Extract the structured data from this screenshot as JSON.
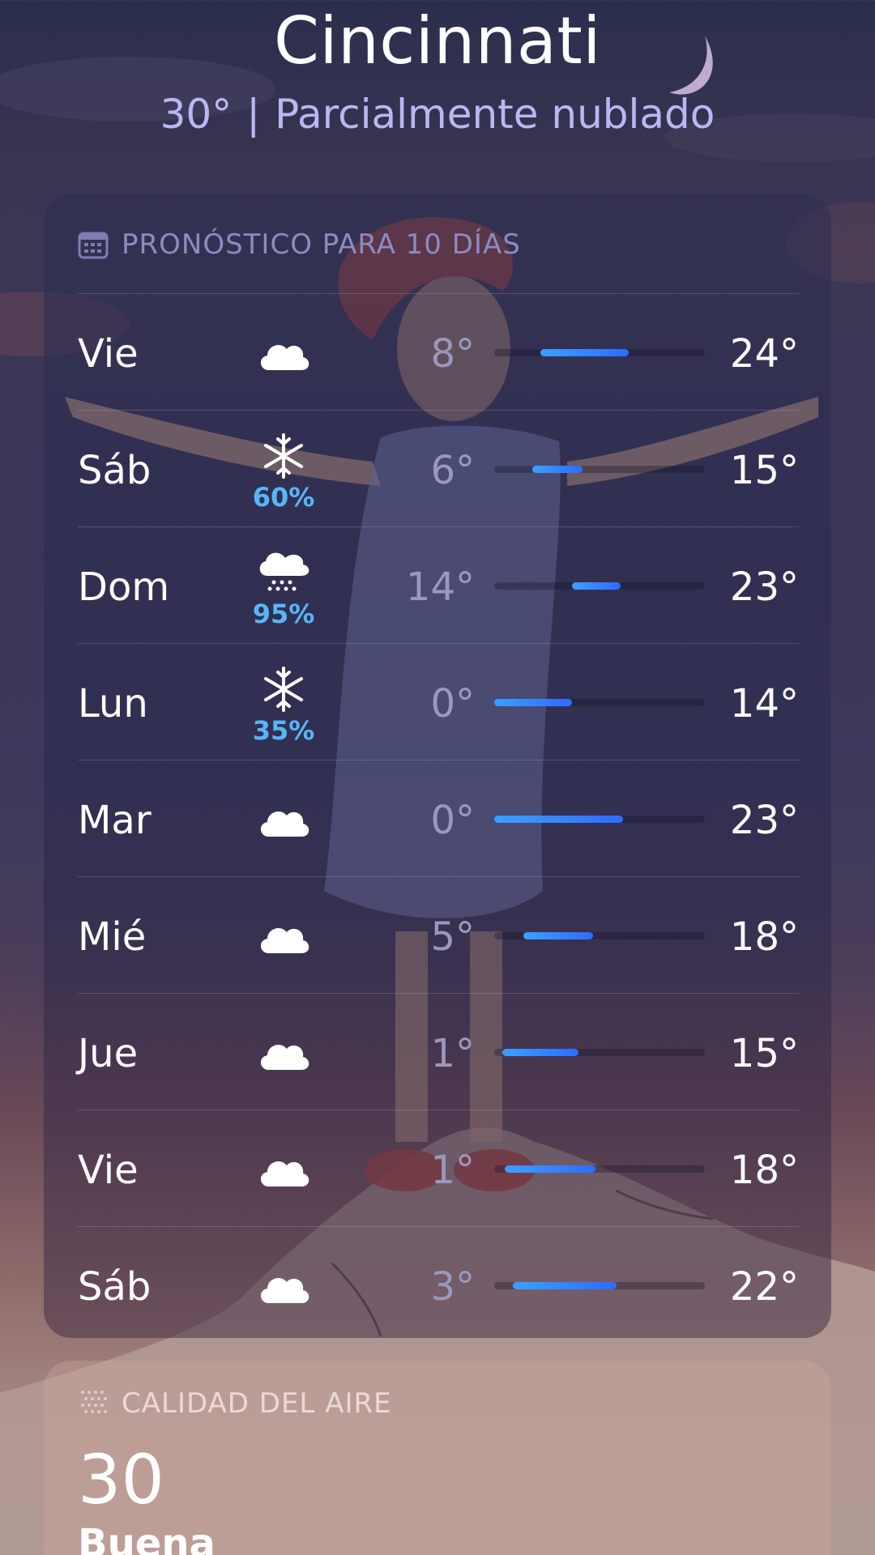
{
  "header": {
    "city": "Cincinnati",
    "current_temp": "30°",
    "separator": "|",
    "condition": "Parcialmente nublado"
  },
  "forecast": {
    "title": "PRONÓSTICO PARA 10 DÍAS",
    "icon": "calendar-icon",
    "days": [
      {
        "day": "Vie",
        "icon": "cloud-icon",
        "precip": "",
        "low": "8°",
        "high": "24°",
        "range_start": 0.22,
        "range_end": 0.64
      },
      {
        "day": "Sáb",
        "icon": "snowflake-icon",
        "precip": "60%",
        "low": "6°",
        "high": "15°",
        "range_start": 0.18,
        "range_end": 0.42
      },
      {
        "day": "Dom",
        "icon": "snow-cloud-icon",
        "precip": "95%",
        "low": "14°",
        "high": "23°",
        "range_start": 0.37,
        "range_end": 0.6
      },
      {
        "day": "Lun",
        "icon": "snowflake-icon",
        "precip": "35%",
        "low": "0°",
        "high": "14°",
        "range_start": 0.0,
        "range_end": 0.37
      },
      {
        "day": "Mar",
        "icon": "cloud-icon",
        "precip": "",
        "low": "0°",
        "high": "23°",
        "range_start": 0.0,
        "range_end": 0.61
      },
      {
        "day": "Mié",
        "icon": "cloud-icon",
        "precip": "",
        "low": "5°",
        "high": "18°",
        "range_start": 0.14,
        "range_end": 0.47
      },
      {
        "day": "Jue",
        "icon": "cloud-icon",
        "precip": "",
        "low": "1°",
        "high": "15°",
        "range_start": 0.04,
        "range_end": 0.4
      },
      {
        "day": "Vie",
        "icon": "cloud-icon",
        "precip": "",
        "low": "1°",
        "high": "18°",
        "range_start": 0.05,
        "range_end": 0.48
      },
      {
        "day": "Sáb",
        "icon": "cloud-icon",
        "precip": "",
        "low": "3°",
        "high": "22°",
        "range_start": 0.09,
        "range_end": 0.58
      }
    ]
  },
  "air_quality": {
    "title": "CALIDAD DEL AIRE",
    "icon": "air-quality-icon",
    "value": "30",
    "label": "Buena"
  }
}
